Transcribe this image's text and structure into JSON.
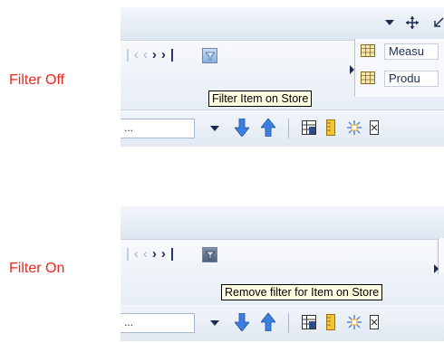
{
  "captions": {
    "filter_off": "Filter Off",
    "filter_on": "Filter On"
  },
  "tooltips": {
    "filter_off": "Filter Item on Store",
    "filter_on": "Remove filter for Item on Store"
  },
  "combo": {
    "value": "..."
  },
  "side_panel": {
    "items": [
      {
        "label": "Measu",
        "icon": "table-icon"
      },
      {
        "label": "Produ",
        "icon": "table-icon"
      }
    ]
  },
  "icons": {
    "nav": [
      "first-page-icon",
      "previous-icon",
      "next-icon",
      "last-page-icon"
    ],
    "toolbar": [
      "dropdown-arrow-icon",
      "move-down-icon",
      "move-up-icon",
      "table-view-icon",
      "ruler-icon",
      "sparkle-icon",
      "export-icon"
    ],
    "top": [
      "dropdown-arrow-icon",
      "move-icon",
      "resize-icon"
    ]
  },
  "colors": {
    "caption": "#e8281e",
    "accent_blue": "#2f6fd6",
    "filter_off_bg": "#9cc2ee",
    "filter_on_bg": "#6a7a93"
  }
}
